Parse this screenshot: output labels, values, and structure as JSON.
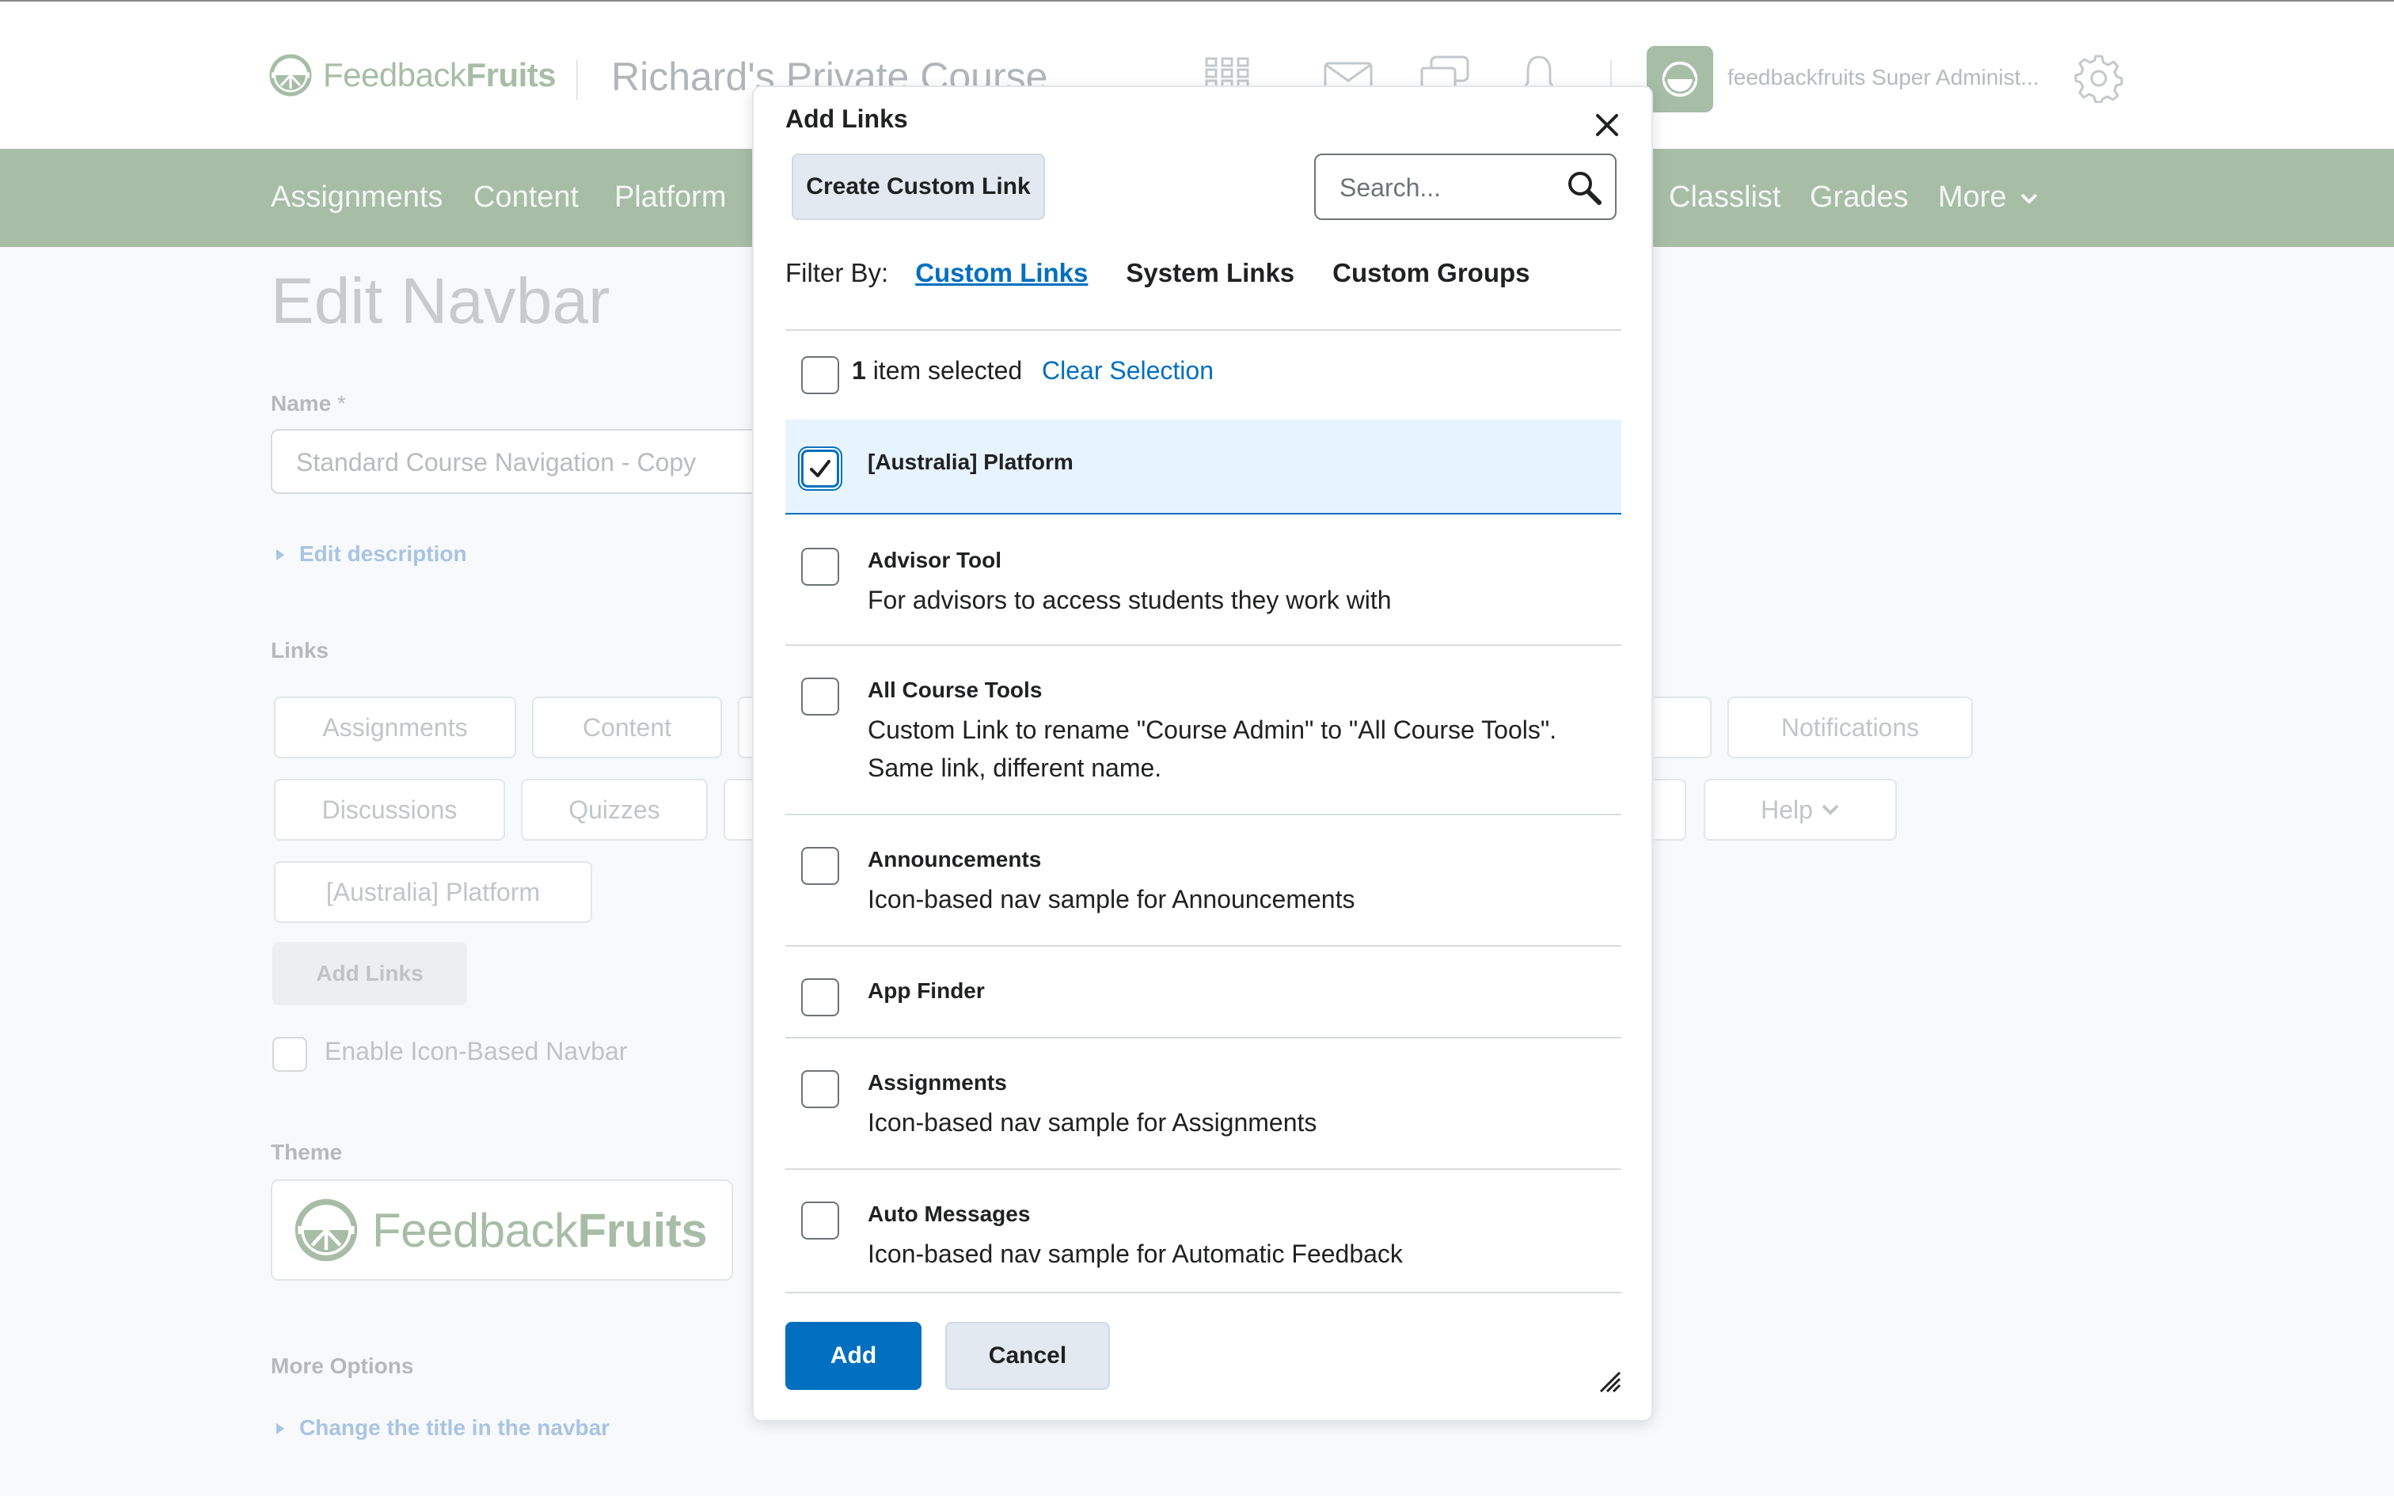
{
  "header": {
    "logo_light": "Feedback",
    "logo_bold": "Fruits",
    "course_title": "Richard's Private Course",
    "admin_name": "feedbackfruits Super Administ...",
    "icons": [
      "grid-icon",
      "mail-icon",
      "chat-icon",
      "bell-icon",
      "gear-icon"
    ]
  },
  "navbar": {
    "items": [
      "Assignments",
      "Content",
      "Platform",
      "Classlist",
      "Grades",
      "More"
    ]
  },
  "page": {
    "title": "Edit Navbar",
    "name_label": "Name",
    "name_required": "*",
    "name_value": "Standard Course Navigation - Copy",
    "edit_description": "Edit description",
    "links_label": "Links",
    "link_chips": [
      "Assignments",
      "Content",
      "Notifications",
      "Discussions",
      "Quizzes",
      "Help",
      "[Australia] Platform"
    ],
    "add_links_button": "Add Links",
    "icon_nav_label": "Enable Icon-Based Navbar",
    "theme_label": "Theme",
    "more_options_label": "More Options",
    "change_title_link": "Change the title in the navbar"
  },
  "modal": {
    "title": "Add Links",
    "create_button": "Create Custom Link",
    "search_placeholder": "Search...",
    "filter_label": "Filter By:",
    "filters": [
      "Custom Links",
      "System Links",
      "Custom Groups"
    ],
    "active_filter": "Custom Links",
    "selected_count": "1",
    "selected_suffix": "item selected",
    "clear_selection": "Clear Selection",
    "items": [
      {
        "title": "[Australia] Platform",
        "desc": "",
        "checked": true
      },
      {
        "title": "Advisor Tool",
        "desc": "For advisors to access students they work with",
        "checked": false
      },
      {
        "title": "All Course Tools",
        "desc": "Custom Link to rename \"Course Admin\" to \"All Course Tools\". Same link, different name.",
        "checked": false
      },
      {
        "title": "Announcements",
        "desc": "Icon-based nav sample for Announcements",
        "checked": false
      },
      {
        "title": "App Finder",
        "desc": "",
        "checked": false
      },
      {
        "title": "Assignments",
        "desc": "Icon-based nav sample for Assignments",
        "checked": false
      },
      {
        "title": "Auto Messages",
        "desc": "Icon-based nav sample for Automatic Feedback",
        "checked": false
      }
    ],
    "add_button": "Add",
    "cancel_button": "Cancel"
  },
  "colors": {
    "brand_green": "#a7bda6",
    "primary_blue": "#006fbf",
    "selected_row_bg": "#e7f3fd"
  }
}
